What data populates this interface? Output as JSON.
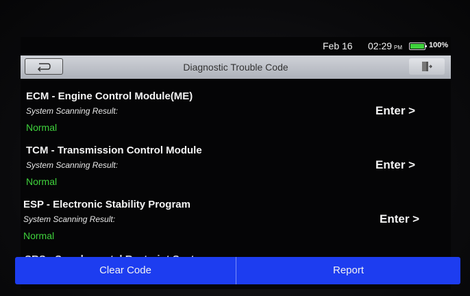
{
  "status_bar": {
    "date": "Feb 16",
    "time": "02:29",
    "ampm": "PM",
    "battery_percent": "100%",
    "battery_level": 1.0
  },
  "header": {
    "title": "Diagnostic Trouble Code",
    "back_icon": "return-arrow-icon",
    "exit_icon": "exit-door-icon"
  },
  "modules": [
    {
      "name": "ECM - Engine Control Module(ME)",
      "scan_label": "System Scanning Result:",
      "status": "Normal",
      "action": "Enter >"
    },
    {
      "name": "TCM - Transmission Control Module",
      "scan_label": "System Scanning Result:",
      "status": "Normal",
      "action": "Enter >"
    },
    {
      "name": "ESP - Electronic Stability Program",
      "scan_label": "System Scanning Result:",
      "status": "Normal",
      "action": "Enter >"
    }
  ],
  "partial_module": {
    "name": "SRS - Supplemental Restraint System"
  },
  "footer": {
    "clear_label": "Clear Code",
    "report_label": "Report"
  },
  "colors": {
    "normal_status": "#3fd23c",
    "bottom_bar": "#1d3df0",
    "battery": "#3fd33c"
  }
}
